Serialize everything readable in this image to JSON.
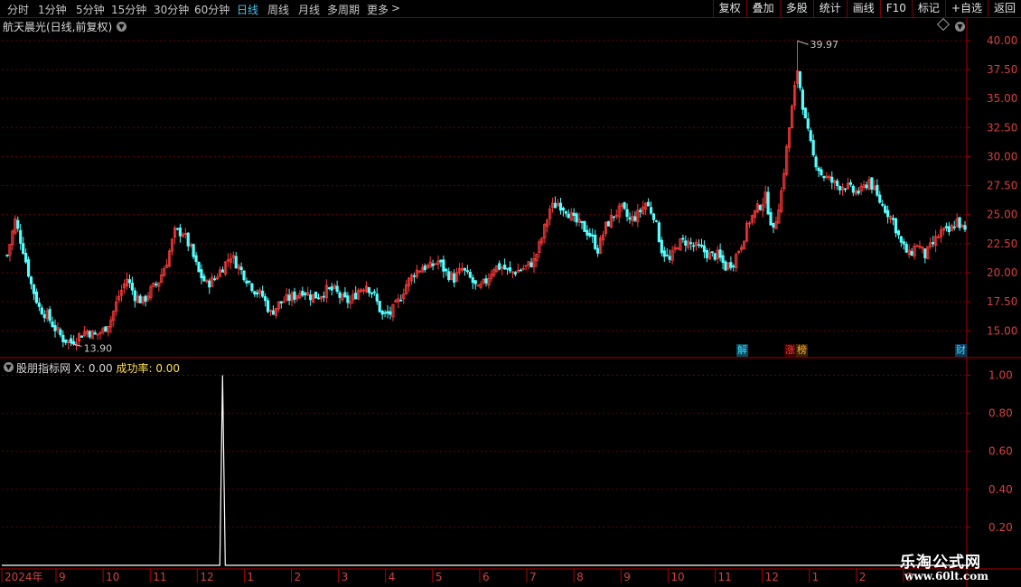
{
  "toolbar": {
    "periods": [
      "分时",
      "1分钟",
      "5分钟",
      "15分钟",
      "30分钟",
      "60分钟",
      "日线",
      "周线",
      "月线",
      "多周期",
      "更多"
    ],
    "active_period": "日线",
    "more_arrow": ">",
    "right_buttons": [
      "复权",
      "叠加",
      "多股",
      "统计",
      "画线",
      "F10",
      "标记",
      "+自选",
      "返回"
    ]
  },
  "stock": {
    "title": "航天晨光(日线,前复权)"
  },
  "main_chart": {
    "price_ticks": [
      "40.00",
      "37.50",
      "35.00",
      "32.50",
      "30.00",
      "27.50",
      "25.00",
      "22.50",
      "20.00",
      "17.50",
      "15.00"
    ],
    "high_label": "39.97",
    "low_label": "13.90",
    "tags": [
      {
        "text": "解",
        "color": "#3fd6ff",
        "bg": "#0a4a5a"
      },
      {
        "text": "涨",
        "color": "#ff4040",
        "bg": "#3a0000"
      },
      {
        "text": "榜",
        "color": "#ffb040",
        "bg": "#3a2400"
      },
      {
        "text": "财",
        "color": "#3fd6ff",
        "bg": "#0a3a5a"
      }
    ]
  },
  "indicator": {
    "name": "股朋指标网",
    "x_label": "X: 0.00",
    "success_label": "成功率: 0.00",
    "ticks": [
      "1.00",
      "0.80",
      "0.60",
      "0.40",
      "0.20"
    ]
  },
  "time_axis": {
    "labels": [
      "2024年",
      "9",
      "10",
      "11",
      "12",
      "1",
      "2",
      "3",
      "4",
      "5",
      "6",
      "7",
      "8",
      "9",
      "10",
      "11",
      "12",
      "1",
      "2",
      "3"
    ]
  },
  "chart_data": {
    "type": "candlestick",
    "title": "航天晨光(日线,前复权)",
    "period": "日线",
    "ylim": [
      13.0,
      41.0
    ],
    "yticks": [
      15.0,
      17.5,
      20.0,
      22.5,
      25.0,
      27.5,
      30.0,
      32.5,
      35.0,
      37.5,
      40.0
    ],
    "x_month_labels": [
      "2024年",
      "9",
      "10",
      "11",
      "12",
      "1",
      "2",
      "3",
      "4",
      "5",
      "6",
      "7",
      "8",
      "9",
      "10",
      "11",
      "12",
      "1",
      "2",
      "3"
    ],
    "close_trend": [
      21.5,
      24.5,
      22.0,
      19.0,
      17.0,
      16.3,
      15.2,
      14.3,
      14.0,
      14.6,
      15.0,
      14.6,
      15.0,
      16.0,
      18.0,
      19.5,
      18.0,
      17.5,
      18.5,
      19.3,
      21.0,
      23.5,
      23.5,
      22.0,
      20.0,
      19.0,
      19.5,
      20.5,
      21.5,
      20.5,
      19.5,
      18.5,
      18.0,
      16.5,
      17.3,
      17.7,
      18.0,
      18.5,
      18.0,
      18.0,
      18.5,
      18.5,
      17.7,
      17.5,
      18.5,
      19.0,
      18.0,
      16.3,
      16.5,
      17.5,
      19.0,
      20.0,
      20.5,
      20.5,
      21.0,
      20.0,
      19.5,
      20.3,
      19.5,
      18.5,
      19.3,
      20.5,
      20.5,
      20.0,
      20.2,
      20.5,
      21.0,
      23.0,
      25.5,
      26.0,
      25.5,
      24.5,
      24.0,
      23.3,
      22.0,
      24.0,
      25.0,
      25.5,
      24.5,
      25.0,
      26.0,
      25.0,
      22.0,
      21.0,
      22.5,
      22.7,
      22.3,
      22.0,
      21.5,
      21.5,
      20.5,
      21.0,
      22.5,
      24.5,
      25.5,
      26.5,
      23.5,
      27.0,
      32.5,
      37.5,
      33.0,
      30.0,
      28.5,
      28.0,
      27.5,
      27.5,
      27.0,
      27.0,
      28.0,
      26.5,
      25.5,
      24.5,
      22.5,
      21.5,
      22.5,
      21.5,
      22.5,
      23.5,
      23.5,
      24.5,
      23.5
    ],
    "high": 39.97,
    "low": 13.9,
    "indicator": {
      "name": "股朋指标网",
      "X": 0.0,
      "success_rate": 0.0,
      "ylim": [
        0.0,
        1.05
      ],
      "yticks": [
        0.2,
        0.4,
        0.6,
        0.8,
        1.0
      ],
      "signal": {
        "month": "12",
        "value": 1.0
      }
    }
  }
}
